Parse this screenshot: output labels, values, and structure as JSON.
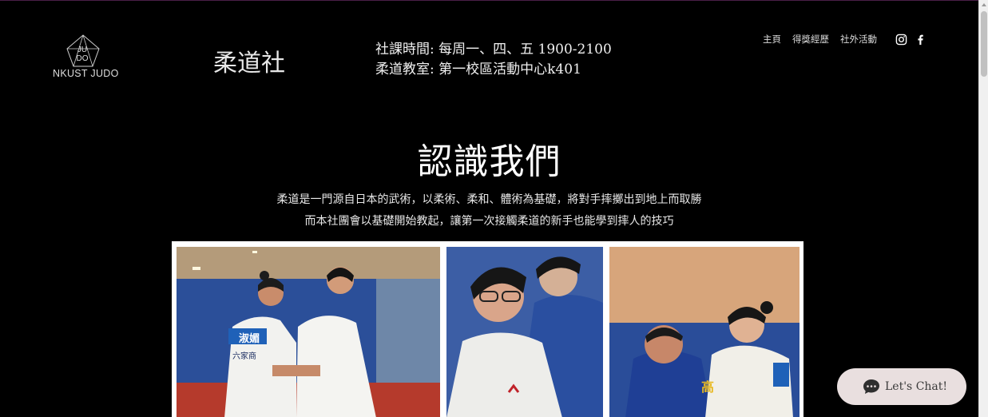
{
  "logo": {
    "mark_top": "JU",
    "mark_bottom": "DO",
    "text": "NKUST JUDO"
  },
  "header": {
    "club_title": "柔道社",
    "schedule_line1": "社課時間: 每周一、四、五 1900-2100",
    "schedule_line2": "柔道教室: 第一校區活動中心k401"
  },
  "nav": {
    "home": "主頁",
    "awards": "得獎經歷",
    "activities": "社外活動"
  },
  "social": {
    "instagram_icon": "instagram-icon",
    "facebook_icon": "facebook-icon"
  },
  "about": {
    "heading": "認識我們",
    "line1": "柔道是一門源自日本的武術，以柔術、柔和、體術為基礎，將對手摔擲出到地上而取勝",
    "line2": "而本社團會以基礎開始教起，讓第一次接觸柔道的新手也能學到摔人的技巧"
  },
  "gallery": {
    "photo1": {
      "name_tag": "淑媚",
      "school_tag": "六家商"
    },
    "photo3": {
      "back_tag": "高"
    }
  },
  "chat": {
    "label": "Let's Chat!",
    "icon": "chat-bubble-icon"
  },
  "colors": {
    "background": "#000000",
    "chat_bg": "#e9dfdf",
    "gallery_frame": "#ffffff"
  }
}
